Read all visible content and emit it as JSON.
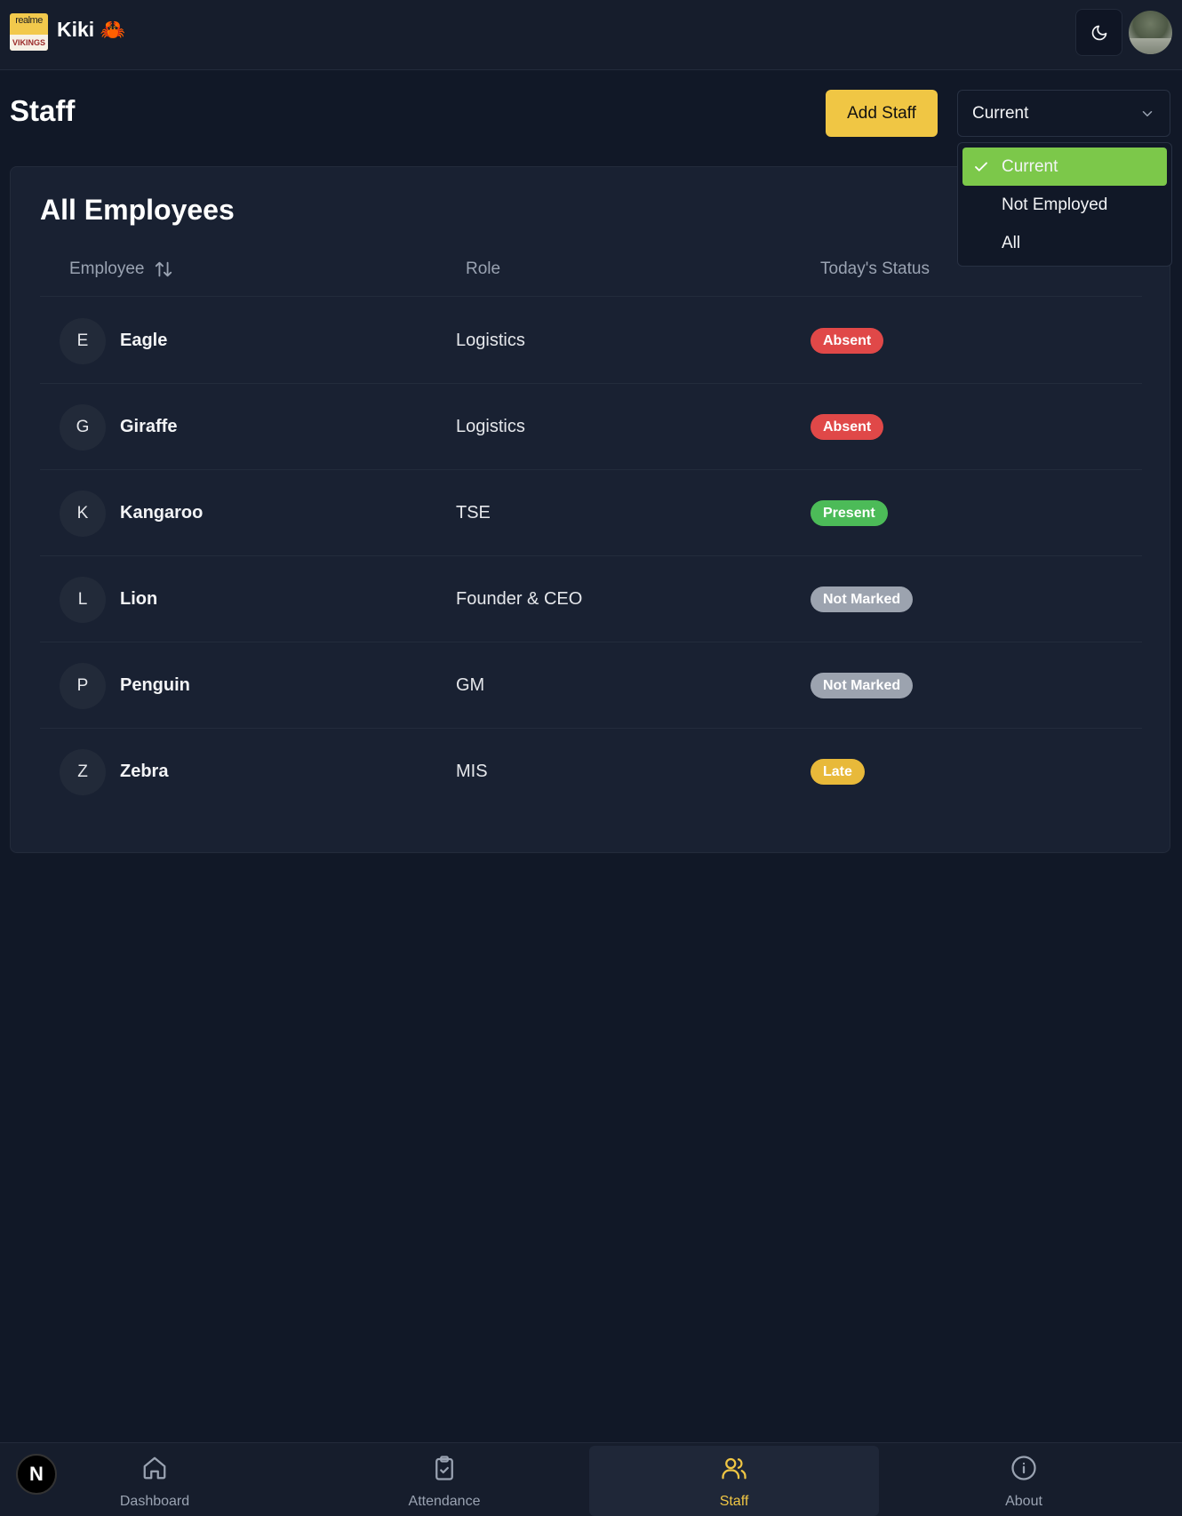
{
  "app": {
    "title": "Kiki 🦀",
    "logo_top": "realme",
    "logo_bottom": "VIKINGS"
  },
  "page": {
    "title": "Staff",
    "add_label": "Add Staff"
  },
  "filter": {
    "value": "Current",
    "options": [
      "Current",
      "Not Employed",
      "All"
    ],
    "selected": "Current"
  },
  "card": {
    "title": "All Employees",
    "headers": {
      "employee": "Employee",
      "role": "Role",
      "status": "Today's Status"
    }
  },
  "employees": [
    {
      "initial": "E",
      "name": "Eagle",
      "role": "Logistics",
      "status": "Absent"
    },
    {
      "initial": "G",
      "name": "Giraffe",
      "role": "Logistics",
      "status": "Absent"
    },
    {
      "initial": "K",
      "name": "Kangaroo",
      "role": "TSE",
      "status": "Present"
    },
    {
      "initial": "L",
      "name": "Lion",
      "role": "Founder & CEO",
      "status": "Not Marked"
    },
    {
      "initial": "P",
      "name": "Penguin",
      "role": "GM",
      "status": "Not Marked"
    },
    {
      "initial": "Z",
      "name": "Zebra",
      "role": "MIS",
      "status": "Late"
    }
  ],
  "status_colors": {
    "Absent": "#e04848",
    "Present": "#4cbb58",
    "Not Marked": "#9ca3af",
    "Late": "#e8b93a"
  },
  "nav": {
    "badge": "N",
    "items": [
      {
        "label": "Dashboard",
        "icon": "home-icon"
      },
      {
        "label": "Attendance",
        "icon": "clipboard-check-icon"
      },
      {
        "label": "Staff",
        "icon": "users-icon",
        "active": true
      },
      {
        "label": "About",
        "icon": "info-icon"
      }
    ]
  },
  "colors": {
    "accent": "#f0c644",
    "selected_option": "#7cc84a",
    "background": "#111827"
  }
}
